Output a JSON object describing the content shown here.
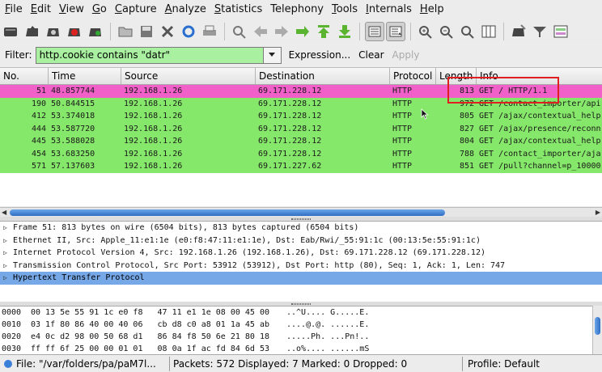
{
  "menubar": {
    "items": [
      {
        "ul": "F",
        "rest": "ile"
      },
      {
        "ul": "E",
        "rest": "dit"
      },
      {
        "ul": "V",
        "rest": "iew"
      },
      {
        "ul": "G",
        "rest": "o"
      },
      {
        "ul": "C",
        "rest": "apture"
      },
      {
        "ul": "A",
        "rest": "nalyze"
      },
      {
        "ul": "S",
        "rest": "tatistics"
      },
      {
        "ul": "",
        "rest": "Telephony"
      },
      {
        "ul": "T",
        "rest": "ools"
      },
      {
        "ul": "I",
        "rest": "nternals"
      },
      {
        "ul": "H",
        "rest": "elp"
      }
    ]
  },
  "toolbar": {
    "icons": [
      "interface-list-icon",
      "capture-options-icon",
      "start-capture-icon",
      "stop-capture-icon",
      "restart-capture-icon",
      "open-file-icon",
      "save-file-icon",
      "close-file-icon",
      "reload-icon",
      "print-icon",
      "find-packet-icon",
      "go-back-icon",
      "go-forward-icon",
      "go-to-packet-icon",
      "go-first-icon",
      "go-last-icon",
      "colorize-icon",
      "autoscroll-icon",
      "zoom-in-icon",
      "zoom-out-icon",
      "zoom-normal-icon",
      "resize-columns-icon",
      "capture-filters-icon",
      "display-filters-icon",
      "coloring-rules-icon"
    ]
  },
  "filter": {
    "label": "Filter:",
    "value": "http.cookie contains \"datr\"",
    "expression_label": "Expression...",
    "clear_label": "Clear",
    "apply_label": "Apply"
  },
  "columns": {
    "no": "No.",
    "time": "Time",
    "source": "Source",
    "destination": "Destination",
    "protocol": "Protocol",
    "length": "Length",
    "info": "Info"
  },
  "packets": [
    {
      "no": "51",
      "time": "48.857744",
      "src": "192.168.1.26",
      "dst": "69.171.228.12",
      "proto": "HTTP",
      "len": "813",
      "info": "GET / HTTP/1.1",
      "bg": "#f060c8"
    },
    {
      "no": "190",
      "time": "50.844515",
      "src": "192.168.1.26",
      "dst": "69.171.228.12",
      "proto": "HTTP",
      "len": "972",
      "info": "GET /contact_importer/api",
      "bg": "#86e86a"
    },
    {
      "no": "412",
      "time": "53.374018",
      "src": "192.168.1.26",
      "dst": "69.171.228.12",
      "proto": "HTTP",
      "len": "805",
      "info": "GET /ajax/contextual_help",
      "bg": "#86e86a"
    },
    {
      "no": "444",
      "time": "53.587720",
      "src": "192.168.1.26",
      "dst": "69.171.228.12",
      "proto": "HTTP",
      "len": "827",
      "info": "GET /ajax/presence/reconn",
      "bg": "#86e86a"
    },
    {
      "no": "445",
      "time": "53.588028",
      "src": "192.168.1.26",
      "dst": "69.171.228.12",
      "proto": "HTTP",
      "len": "804",
      "info": "GET /ajax/contextual_help",
      "bg": "#86e86a"
    },
    {
      "no": "454",
      "time": "53.683250",
      "src": "192.168.1.26",
      "dst": "69.171.228.12",
      "proto": "HTTP",
      "len": "788",
      "info": "GET /contact_importer/aja",
      "bg": "#86e86a"
    },
    {
      "no": "571",
      "time": "57.137603",
      "src": "192.168.1.26",
      "dst": "69.171.227.62",
      "proto": "HTTP",
      "len": "851",
      "info": "GET /pull?channel=p_10000",
      "bg": "#86e86a"
    }
  ],
  "details": [
    {
      "text": "Frame 51: 813 bytes on wire (6504 bits), 813 bytes captured (6504 bits)",
      "selected": false
    },
    {
      "text": "Ethernet II, Src: Apple_11:e1:1e (e0:f8:47:11:e1:1e), Dst: Eab/Rwi/_55:91:1c (00:13:5e:55:91:1c)",
      "selected": false
    },
    {
      "text": "Internet Protocol Version 4, Src: 192.168.1.26 (192.168.1.26), Dst: 69.171.228.12 (69.171.228.12)",
      "selected": false
    },
    {
      "text": "Transmission Control Protocol, Src Port: 53912 (53912), Dst Port: http (80), Seq: 1, Ack: 1, Len: 747",
      "selected": false
    },
    {
      "text": "Hypertext Transfer Protocol",
      "selected": true
    }
  ],
  "bytes": [
    {
      "offset": "0000",
      "hex": "00 13 5e 55 91 1c e0 f8   47 11 e1 1e 08 00 45 00",
      "ascii": "..^U.... G.....E."
    },
    {
      "offset": "0010",
      "hex": "03 1f 80 86 40 00 40 06   cb d8 c0 a8 01 1a 45 ab",
      "ascii": "....@.@. ......E."
    },
    {
      "offset": "0020",
      "hex": "e4 0c d2 98 00 50 68 d1   86 84 f8 50 6e 21 80 18",
      "ascii": ".....Ph. ...Pn!.."
    },
    {
      "offset": "0030",
      "hex": "ff ff 6f 25 00 00 01 01   08 0a 1f ac fd 84 6d 53",
      "ascii": "..o%.... ......mS"
    }
  ],
  "status": {
    "file": "File: \"/var/folders/pa/paM7l...",
    "packets": "Packets: 572 Displayed: 7 Marked: 0 Dropped: 0",
    "profile": "Profile: Default"
  },
  "colors": {
    "selected_row": "#f060c8",
    "http_row": "#86e86a",
    "filter_ok": "#a9f0a0",
    "highlight": "#e02020",
    "tree_selected": "#76a8e8"
  }
}
